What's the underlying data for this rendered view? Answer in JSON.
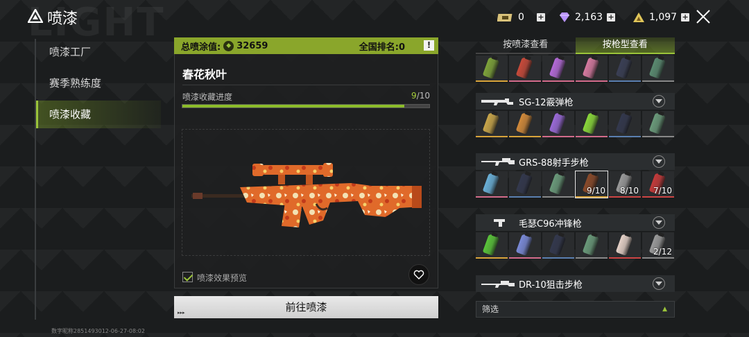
{
  "header": {
    "watermark": "LIGHT",
    "title": "喷漆",
    "currencies": [
      {
        "name": "ticket-icon",
        "value": "0",
        "color": "#d9c27a"
      },
      {
        "name": "diamond-icon",
        "value": "2,163",
        "color": "#b892ff"
      },
      {
        "name": "coin-icon",
        "value": "1,097",
        "color": "#e0c65a"
      }
    ]
  },
  "nav": {
    "items": [
      {
        "label": "喷漆工厂",
        "active": false
      },
      {
        "label": "赛季熟练度",
        "active": false
      },
      {
        "label": "喷漆收藏",
        "active": true
      }
    ]
  },
  "footer": {
    "user_id": "数字昵称2851493012-06-27-08:02"
  },
  "center": {
    "score_label": "总喷涂值:",
    "score_value": "32659",
    "rank_label": "全国排名:0",
    "skin_name": "春花秋叶",
    "progress_label": "喷漆收藏进度",
    "progress_current": "9",
    "progress_total": "/10",
    "progress_fraction": 0.9,
    "preview_toggle": "喷漆效果预览",
    "go_button": "前往喷漆",
    "colors": {
      "accent": "#9bc43a",
      "score_bar": "#8aa62b"
    }
  },
  "right": {
    "tabs": [
      {
        "label": "按喷漆查看",
        "active": false
      },
      {
        "label": "按枪型查看",
        "active": true
      }
    ],
    "top_row": [
      {
        "fill": "#7ea33a",
        "rarity": "gold"
      },
      {
        "fill": "#c84a3a",
        "rarity": "pink"
      },
      {
        "fill": "#b46ad8",
        "rarity": "pink"
      },
      {
        "fill": "#d67aa0",
        "rarity": "pink"
      },
      {
        "fill": "#3a3f55",
        "rarity": "blue"
      },
      {
        "fill": "#5a8a70",
        "rarity": "grey"
      }
    ],
    "groups": [
      {
        "name": "SG-12霰弹枪",
        "slots": [
          {
            "fill": "#c9a64a",
            "rarity": "gold",
            "count": ""
          },
          {
            "fill": "#d28a3a",
            "rarity": "gold",
            "count": ""
          },
          {
            "fill": "#9a6ad8",
            "rarity": "pink",
            "count": ""
          },
          {
            "fill": "#8ad83a",
            "rarity": "pink",
            "count": ""
          },
          {
            "fill": "#33384d",
            "rarity": "blue",
            "count": ""
          },
          {
            "fill": "#6a9a7a",
            "rarity": "grey",
            "count": ""
          }
        ]
      },
      {
        "name": "GRS-88射手步枪",
        "slots": [
          {
            "fill": "#6ab0d8",
            "rarity": "pink",
            "count": ""
          },
          {
            "fill": "#33384d",
            "rarity": "blue",
            "count": ""
          },
          {
            "fill": "#6a9a7a",
            "rarity": "grey",
            "count": ""
          },
          {
            "fill": "#8a4a2a",
            "rarity": "gold",
            "count": "9/10",
            "selected": true
          },
          {
            "fill": "#9a9a9a",
            "rarity": "red",
            "count": "8/10"
          },
          {
            "fill": "#c43a3a",
            "rarity": "red",
            "count": "7/10"
          }
        ]
      },
      {
        "name": "毛瑟C96冲锋枪",
        "slots": [
          {
            "fill": "#5ac43a",
            "rarity": "gold",
            "count": ""
          },
          {
            "fill": "#7a8ad8",
            "rarity": "pink",
            "count": ""
          },
          {
            "fill": "#33384d",
            "rarity": "blue",
            "count": ""
          },
          {
            "fill": "#6a9a7a",
            "rarity": "grey",
            "count": ""
          },
          {
            "fill": "#e6d2c8",
            "rarity": "red",
            "count": ""
          },
          {
            "fill": "#9a9a9a",
            "rarity": "grey",
            "count": "2/12"
          }
        ]
      },
      {
        "name": "DR-10狙击步枪",
        "slots": []
      }
    ],
    "filter_label": "筛选"
  }
}
